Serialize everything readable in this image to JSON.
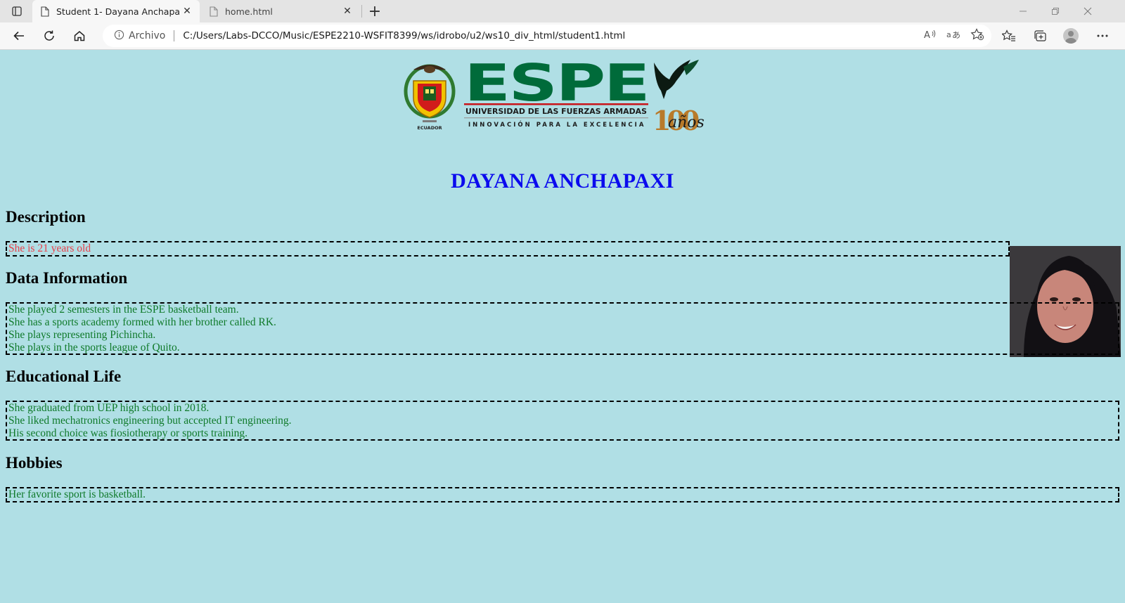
{
  "browser": {
    "tabs": [
      {
        "title": "Student 1- Dayana Anchapaxi",
        "active": true
      },
      {
        "title": "home.html",
        "active": false
      }
    ],
    "address": {
      "info_label": "Archivo",
      "url": "C:/Users/Labs-DCCO/Music/ESPE2210-WSFIT8399/ws/idrobo/u2/ws10_div_html/student1.html"
    }
  },
  "page": {
    "logo": {
      "name": "ESPE",
      "subtitle": "UNIVERSIDAD DE LAS FUERZAS ARMADAS",
      "motto": "INNOVACIÓN PARA LA EXCELENCIA",
      "seal_text": "ECUADOR",
      "anniversary_num": "100",
      "anniversary_word": "años"
    },
    "title": "DAYANA ANCHAPAXI",
    "sections": {
      "description": {
        "heading": "Description",
        "lines": [
          "She is 21 years old"
        ]
      },
      "data_information": {
        "heading": "Data Information",
        "lines": [
          "She played 2 semesters in the ESPE basketball team.",
          "She has a sports academy formed with her brother called RK.",
          "She plays representing Pichincha.",
          "She plays in the sports league of Quito."
        ]
      },
      "educational_life": {
        "heading": "Educational Life",
        "lines": [
          "She graduated from UEP high school in 2018.",
          "She liked mechatronics engineering but accepted IT engineering.",
          "His second choice was fiosiotherapy or sports training."
        ]
      },
      "hobbies": {
        "heading": "Hobbies",
        "lines": [
          "Her favorite sport is basketball."
        ]
      }
    }
  },
  "colors": {
    "background": "#b0dfe5",
    "title": "#0b0bee",
    "description_text": "#e8404a",
    "body_text": "#0f7a2a",
    "espe_green": "#006b3a"
  }
}
